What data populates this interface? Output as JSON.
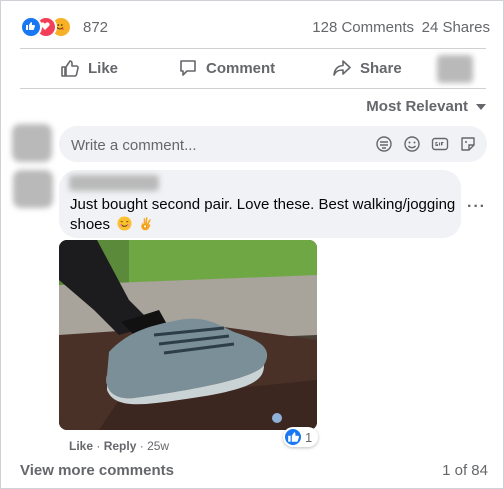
{
  "stats": {
    "reaction_icons": [
      "like-icon",
      "love-icon",
      "care-icon"
    ],
    "reaction_count": "872",
    "comments_label": "128 Comments",
    "shares_label": "24 Shares"
  },
  "actions": {
    "like": "Like",
    "comment": "Comment",
    "share": "Share"
  },
  "sort": {
    "label": "Most Relevant"
  },
  "composer": {
    "placeholder": "Write a comment...",
    "icons": [
      "sticker-icon",
      "emoji-icon",
      "gif-icon",
      "photo-sticker-icon"
    ]
  },
  "comment": {
    "text": "Just bought second pair. Love these. Best walking/jogging shoes",
    "emojis": [
      "smiling-face-emoji",
      "ok-hand-emoji"
    ],
    "like_label": "Like",
    "reply_label": "Reply",
    "separator": "·",
    "age": "25w",
    "like_count": "1"
  },
  "footer": {
    "view_more": "View more comments",
    "pagination": "1 of 84"
  },
  "colors": {
    "facebook_blue": "#1877f2",
    "love_red": "#f33e58",
    "secondary_text": "#65676b",
    "bubble_bg": "#f0f2f5"
  }
}
